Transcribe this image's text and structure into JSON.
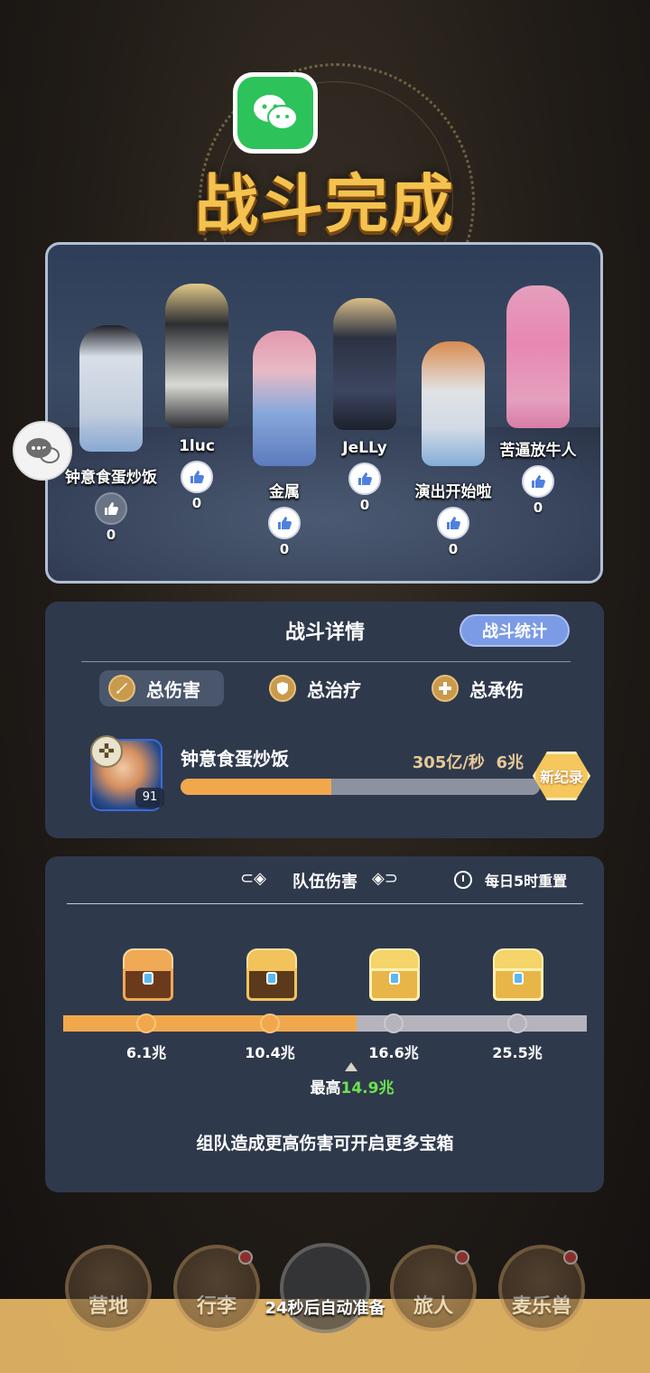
{
  "title": "战斗完成",
  "icons": {
    "wechat": "wechat-icon",
    "chat": "chat-bubble-icon",
    "like": "thumbs-up-icon",
    "damage": "sword-icon",
    "heal": "shield-icon",
    "tank": "cross-icon",
    "clock": "clock-icon"
  },
  "team": [
    {
      "name": "钟意食蛋炒饭",
      "likes": "0",
      "liked": false
    },
    {
      "name": "1luc",
      "likes": "0",
      "liked": true
    },
    {
      "name": "金属",
      "likes": "0",
      "liked": true
    },
    {
      "name": "JeLLy",
      "likes": "0",
      "liked": true
    },
    {
      "name": "演出开始啦",
      "likes": "0",
      "liked": true
    },
    {
      "name": "苦逼放牛人",
      "likes": "0",
      "liked": true
    }
  ],
  "detail": {
    "title": "战斗详情",
    "stats_button": "战斗统计",
    "tabs": [
      "总伤害",
      "总治疗",
      "总承伤"
    ],
    "player": {
      "name": "钟意食蛋炒饭",
      "level": "91",
      "rate": "305亿/秒",
      "total": "6兆",
      "progress": 0.42,
      "badge": "新纪录"
    }
  },
  "team_damage": {
    "title": "队伍伤害",
    "reset": "每日5时重置",
    "milestones": [
      "6.1兆",
      "10.4兆",
      "16.6兆",
      "25.5兆"
    ],
    "progress": 0.56,
    "peak_label": "最高",
    "peak_value": "14.9兆",
    "hint": "组队造成更高伤害可开启更多宝箱"
  },
  "nav": {
    "items": [
      "营地",
      "行李",
      "",
      "旅人",
      "麦乐兽"
    ],
    "auto_ready": "24秒后自动准备"
  },
  "colors": {
    "accent_orange": "#f1a84c",
    "title_gold": "#f4c24e",
    "panel": "#2f394c",
    "stats_button": "#7b9be6",
    "peak_green": "#6de24e"
  }
}
